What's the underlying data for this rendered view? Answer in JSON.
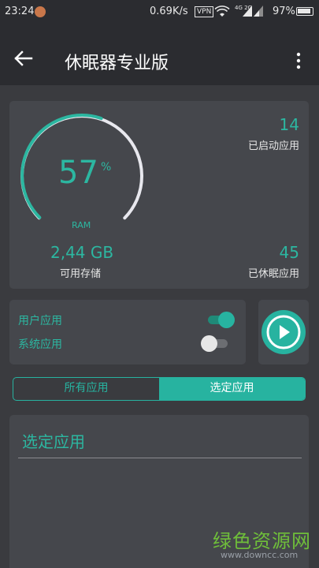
{
  "status_bar": {
    "time": "23:24",
    "net_speed": "0.69K/s",
    "vpn": "VPN",
    "network": "4G 2G",
    "battery": "97%"
  },
  "app_bar": {
    "title": "休眠器专业版",
    "back_icon": "arrow-left-icon",
    "menu_icon": "more-vert-icon"
  },
  "stats": {
    "ram_percent": "57",
    "ram_percent_sign": "%",
    "ram_label": "RAM",
    "ram_fraction": 0.57,
    "available_memory_value": "2,44 GB",
    "available_memory_label": "可用存储",
    "launched_apps_count": "14",
    "launched_apps_label": "已启动应用",
    "sleeping_apps_count": "45",
    "sleeping_apps_label": "已休眠应用"
  },
  "filters": {
    "user_apps_label": "用户应用",
    "user_apps_enabled": true,
    "system_apps_label": "系统应用",
    "system_apps_enabled": false
  },
  "play_icon": "play-icon",
  "tabs": {
    "all_apps": "所有应用",
    "selected_apps": "选定应用",
    "active": "selected_apps"
  },
  "list": {
    "title": "选定应用"
  },
  "watermark": {
    "site_name": "绿色资源网",
    "site_url": "www.downcc.com"
  },
  "colors": {
    "accent": "#27b3a0",
    "background": "#3a3b3f",
    "card": "#45474c",
    "appbar": "#2b2c30"
  }
}
